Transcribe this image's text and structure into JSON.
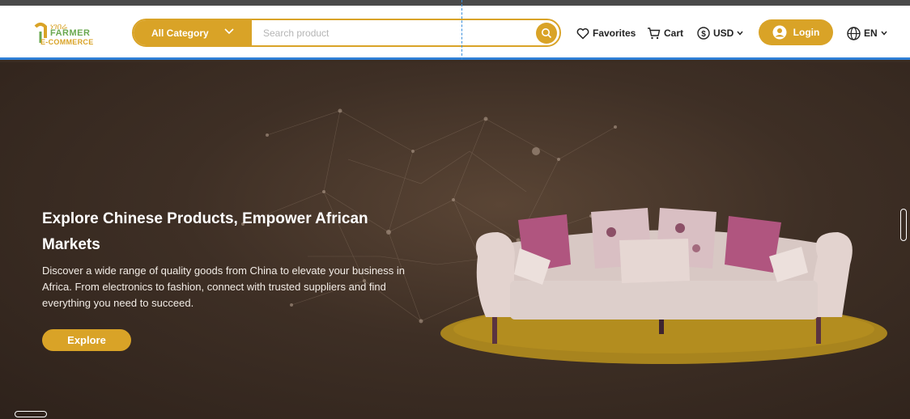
{
  "brand": {
    "logo_script": "ነገበሬ",
    "logo_line1": "FARMER",
    "logo_line2": "E-COMMERCE"
  },
  "search": {
    "category_label": "All Category",
    "placeholder": "Search product"
  },
  "nav": {
    "favorites": "Favorites",
    "cart": "Cart",
    "currency": "USD",
    "login": "Login",
    "language": "EN"
  },
  "hero": {
    "title": "Explore Chinese Products, Empower African Markets",
    "description": "Discover a wide range of quality goods from China to elevate your business in Africa. From electronics to fashion, connect with trusted suppliers and find everything you need to succeed.",
    "cta": "Explore"
  },
  "colors": {
    "accent": "#d9a327",
    "hero_bg": "#3e2f25",
    "header_border": "#2f7fd6"
  },
  "icons": [
    "search-icon",
    "heart-icon",
    "cart-icon",
    "dollar-icon",
    "chevron-down-icon",
    "user-icon",
    "globe-icon"
  ]
}
